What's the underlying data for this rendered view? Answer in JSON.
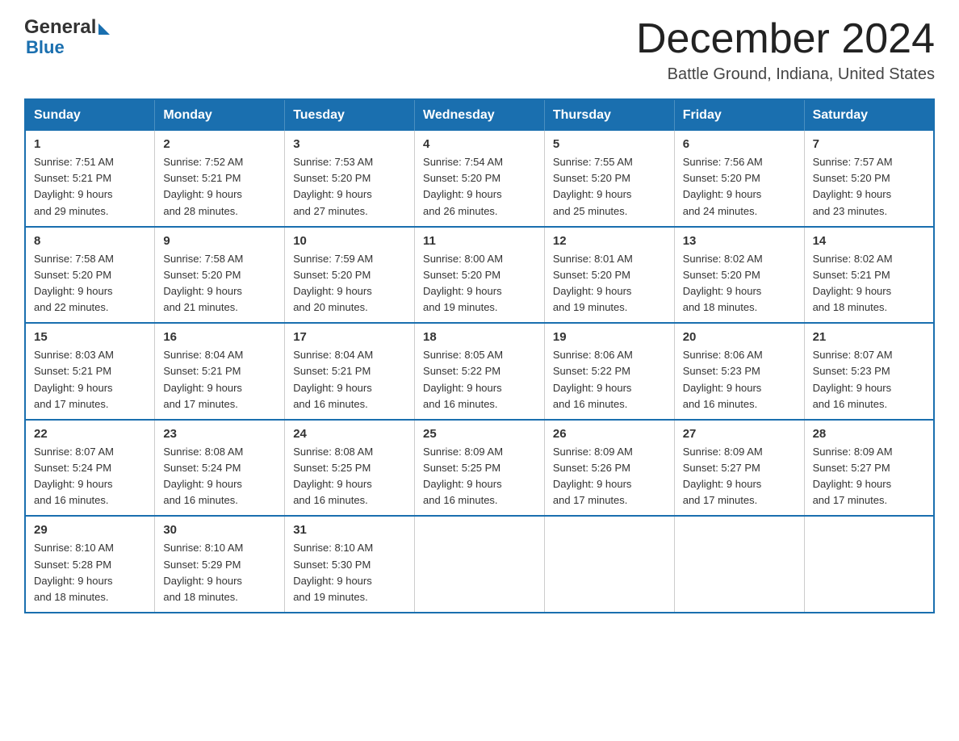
{
  "header": {
    "logo": {
      "general": "General",
      "blue": "Blue"
    },
    "title": "December 2024",
    "subtitle": "Battle Ground, Indiana, United States"
  },
  "days_of_week": [
    "Sunday",
    "Monday",
    "Tuesday",
    "Wednesday",
    "Thursday",
    "Friday",
    "Saturday"
  ],
  "weeks": [
    [
      {
        "day": "1",
        "sunrise": "7:51 AM",
        "sunset": "5:21 PM",
        "daylight": "9 hours and 29 minutes."
      },
      {
        "day": "2",
        "sunrise": "7:52 AM",
        "sunset": "5:21 PM",
        "daylight": "9 hours and 28 minutes."
      },
      {
        "day": "3",
        "sunrise": "7:53 AM",
        "sunset": "5:20 PM",
        "daylight": "9 hours and 27 minutes."
      },
      {
        "day": "4",
        "sunrise": "7:54 AM",
        "sunset": "5:20 PM",
        "daylight": "9 hours and 26 minutes."
      },
      {
        "day": "5",
        "sunrise": "7:55 AM",
        "sunset": "5:20 PM",
        "daylight": "9 hours and 25 minutes."
      },
      {
        "day": "6",
        "sunrise": "7:56 AM",
        "sunset": "5:20 PM",
        "daylight": "9 hours and 24 minutes."
      },
      {
        "day": "7",
        "sunrise": "7:57 AM",
        "sunset": "5:20 PM",
        "daylight": "9 hours and 23 minutes."
      }
    ],
    [
      {
        "day": "8",
        "sunrise": "7:58 AM",
        "sunset": "5:20 PM",
        "daylight": "9 hours and 22 minutes."
      },
      {
        "day": "9",
        "sunrise": "7:58 AM",
        "sunset": "5:20 PM",
        "daylight": "9 hours and 21 minutes."
      },
      {
        "day": "10",
        "sunrise": "7:59 AM",
        "sunset": "5:20 PM",
        "daylight": "9 hours and 20 minutes."
      },
      {
        "day": "11",
        "sunrise": "8:00 AM",
        "sunset": "5:20 PM",
        "daylight": "9 hours and 19 minutes."
      },
      {
        "day": "12",
        "sunrise": "8:01 AM",
        "sunset": "5:20 PM",
        "daylight": "9 hours and 19 minutes."
      },
      {
        "day": "13",
        "sunrise": "8:02 AM",
        "sunset": "5:20 PM",
        "daylight": "9 hours and 18 minutes."
      },
      {
        "day": "14",
        "sunrise": "8:02 AM",
        "sunset": "5:21 PM",
        "daylight": "9 hours and 18 minutes."
      }
    ],
    [
      {
        "day": "15",
        "sunrise": "8:03 AM",
        "sunset": "5:21 PM",
        "daylight": "9 hours and 17 minutes."
      },
      {
        "day": "16",
        "sunrise": "8:04 AM",
        "sunset": "5:21 PM",
        "daylight": "9 hours and 17 minutes."
      },
      {
        "day": "17",
        "sunrise": "8:04 AM",
        "sunset": "5:21 PM",
        "daylight": "9 hours and 16 minutes."
      },
      {
        "day": "18",
        "sunrise": "8:05 AM",
        "sunset": "5:22 PM",
        "daylight": "9 hours and 16 minutes."
      },
      {
        "day": "19",
        "sunrise": "8:06 AM",
        "sunset": "5:22 PM",
        "daylight": "9 hours and 16 minutes."
      },
      {
        "day": "20",
        "sunrise": "8:06 AM",
        "sunset": "5:23 PM",
        "daylight": "9 hours and 16 minutes."
      },
      {
        "day": "21",
        "sunrise": "8:07 AM",
        "sunset": "5:23 PM",
        "daylight": "9 hours and 16 minutes."
      }
    ],
    [
      {
        "day": "22",
        "sunrise": "8:07 AM",
        "sunset": "5:24 PM",
        "daylight": "9 hours and 16 minutes."
      },
      {
        "day": "23",
        "sunrise": "8:08 AM",
        "sunset": "5:24 PM",
        "daylight": "9 hours and 16 minutes."
      },
      {
        "day": "24",
        "sunrise": "8:08 AM",
        "sunset": "5:25 PM",
        "daylight": "9 hours and 16 minutes."
      },
      {
        "day": "25",
        "sunrise": "8:09 AM",
        "sunset": "5:25 PM",
        "daylight": "9 hours and 16 minutes."
      },
      {
        "day": "26",
        "sunrise": "8:09 AM",
        "sunset": "5:26 PM",
        "daylight": "9 hours and 17 minutes."
      },
      {
        "day": "27",
        "sunrise": "8:09 AM",
        "sunset": "5:27 PM",
        "daylight": "9 hours and 17 minutes."
      },
      {
        "day": "28",
        "sunrise": "8:09 AM",
        "sunset": "5:27 PM",
        "daylight": "9 hours and 17 minutes."
      }
    ],
    [
      {
        "day": "29",
        "sunrise": "8:10 AM",
        "sunset": "5:28 PM",
        "daylight": "9 hours and 18 minutes."
      },
      {
        "day": "30",
        "sunrise": "8:10 AM",
        "sunset": "5:29 PM",
        "daylight": "9 hours and 18 minutes."
      },
      {
        "day": "31",
        "sunrise": "8:10 AM",
        "sunset": "5:30 PM",
        "daylight": "9 hours and 19 minutes."
      },
      null,
      null,
      null,
      null
    ]
  ],
  "labels": {
    "sunrise": "Sunrise:",
    "sunset": "Sunset:",
    "daylight": "Daylight:"
  }
}
